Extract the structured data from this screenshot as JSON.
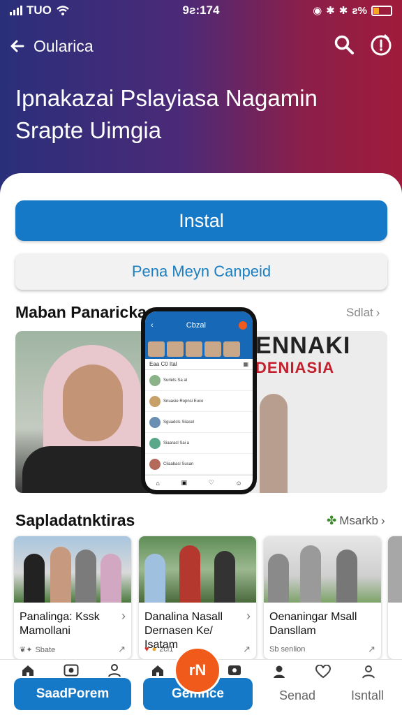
{
  "status_bar": {
    "carrier": "TUO",
    "time": "9ƨ:174",
    "battery_text": "ƨ%",
    "battery_level": 0.35
  },
  "header": {
    "title": "Oularica",
    "headline": "Ipnakazai Pslayiasa Nagamin Srapte Uimgia"
  },
  "actions": {
    "install_label": "Instal",
    "secondary_label": "Pena Meyn Canpeid"
  },
  "featured": {
    "title": "Maban Panaricka",
    "see_all": "Sdlat",
    "sign_line1": "ENNAKI",
    "sign_line2": "DENIASIA",
    "phone": {
      "app_title": "Cbzal",
      "tab_left": "Eaa C0 Ital",
      "chats": [
        "Surlets Sa al",
        "Snuasie Ropnsi Euco",
        "Sguadcls Silasel",
        "Siaaracl Sai a",
        "Cliaabasi Susan"
      ]
    }
  },
  "stories": {
    "title": "Sapladatnktiras",
    "see_all": "Msarkb",
    "items": [
      {
        "title": "Panalinga: Kssk Mamollani",
        "meta": "Sbate"
      },
      {
        "title": "Danalina Nasall Dernasen Ke/ Isatam",
        "meta": "2ci1"
      },
      {
        "title": "Oenaningar Msall Dansllam",
        "meta": "Sb senlion"
      }
    ]
  },
  "bottom_nav": {
    "btn_left": "SaadPorem",
    "btn_mid": "Gemnce",
    "fab_label": "rN",
    "label_1": "Senad",
    "label_2": "Isntall"
  },
  "colors": {
    "primary": "#1679c8",
    "accent": "#f05a1a",
    "hero_start": "#2a2f7a",
    "hero_end": "#a01b3b"
  }
}
